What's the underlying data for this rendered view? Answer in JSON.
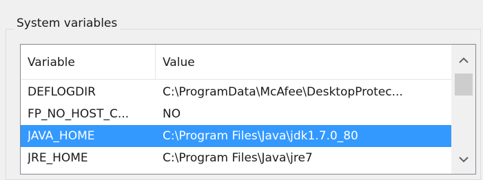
{
  "group": {
    "title": "System variables"
  },
  "table": {
    "columns": [
      "Variable",
      "Value"
    ],
    "rows": [
      {
        "variable": "DEFLOGDIR",
        "value": "C:\\ProgramData\\McAfee\\DesktopProtec...",
        "selected": false
      },
      {
        "variable": "FP_NO_HOST_C...",
        "value": "NO",
        "selected": false
      },
      {
        "variable": "JAVA_HOME",
        "value": "C:\\Program Files\\Java\\jdk1.7.0_80",
        "selected": true
      },
      {
        "variable": "JRE_HOME",
        "value": "C:\\Program Files\\Java\\jre7",
        "selected": false
      }
    ]
  },
  "scrollbar": {
    "up_icon": "chevron-up-icon",
    "down_icon": "chevron-down-icon"
  },
  "colors": {
    "selection": "#3399ff",
    "background": "#f0f0f0"
  }
}
